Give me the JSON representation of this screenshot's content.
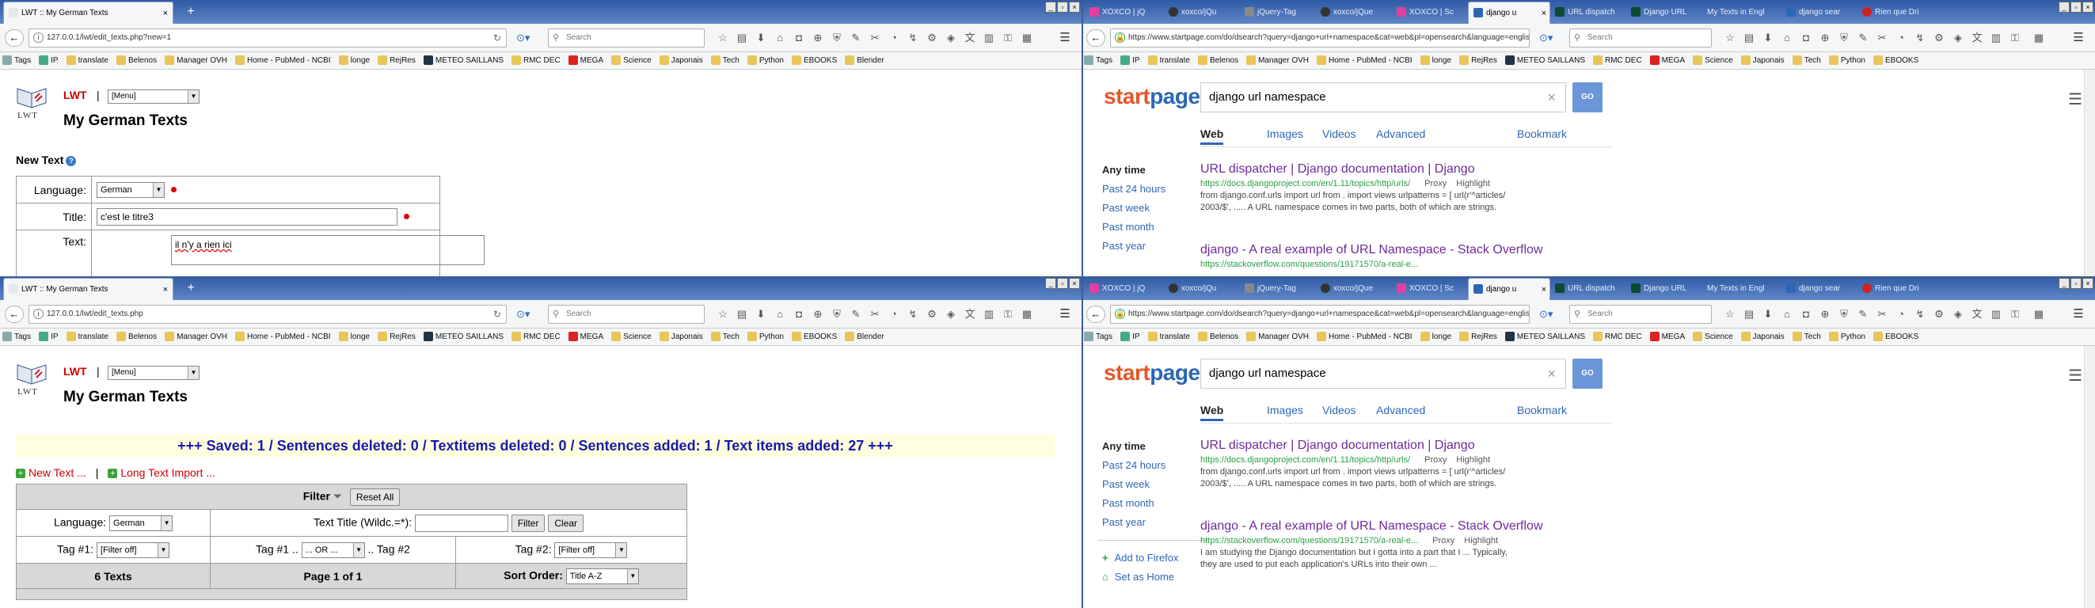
{
  "colors": {
    "tabbar": "#3a64ac",
    "accent_red": "#cc0000",
    "link_blue": "#2c67b6",
    "visited": "#6f2a9a",
    "url_green": "#28a243",
    "saved_bg": "#ffffe0"
  },
  "bookmarks": [
    {
      "label": "Tags",
      "icon": "tag-icon"
    },
    {
      "label": "IP",
      "icon": "ip-icon"
    },
    {
      "label": "translate",
      "icon": "folder-icon"
    },
    {
      "label": "Belenos",
      "icon": "folder-icon"
    },
    {
      "label": "Manager OVH",
      "icon": "folder-icon"
    },
    {
      "label": "Home - PubMed - NCBI",
      "icon": "ncbi-icon"
    },
    {
      "label": "longe",
      "icon": "folder-icon"
    },
    {
      "label": "RejRes",
      "icon": "folder-icon"
    },
    {
      "label": "METEO SAILLANS",
      "icon": "meteo-icon"
    },
    {
      "label": "RMC DEC",
      "icon": "rmc-icon"
    },
    {
      "label": "MEGA",
      "icon": "mega-icon"
    },
    {
      "label": "Science",
      "icon": "folder-icon"
    },
    {
      "label": "Japonais",
      "icon": "folder-icon"
    },
    {
      "label": "Tech",
      "icon": "folder-icon"
    },
    {
      "label": "Python",
      "icon": "folder-icon"
    },
    {
      "label": "EBOOKS",
      "icon": "folder-icon"
    },
    {
      "label": "Blender",
      "icon": "folder-icon"
    }
  ],
  "tl": {
    "tab": {
      "title": "LWT :: My German Texts",
      "close": "×"
    },
    "new_tab": "+",
    "url": "127.0.0.1/lwt/edit_texts.php?new=1",
    "search_placeholder": "Search",
    "lwt": {
      "name": "LWT",
      "pipe": "|",
      "menu": "[Menu]",
      "logo_text": "LWT",
      "heading": "My German Texts"
    },
    "form": {
      "section": "New Text",
      "help": "?",
      "language_label": "Language:",
      "language_value": "German",
      "title_label": "Title:",
      "title_value": "c'est le titre3",
      "text_label": "Text:",
      "text_value": "il n'y a rien ici"
    }
  },
  "tr": {
    "tabs": [
      "XOXCO | jQ",
      "xoxco/jQu",
      "jQuery-Tag",
      "xoxco/jQue",
      "XOXCO | Sc",
      "django u",
      "URL dispatch",
      "Django URL",
      "My Texts in Engl",
      "django sear",
      "Rien que Dri"
    ],
    "url": "https://www.startpage.com/do/dsearch?query=django+url+namespace&cat=web&pl=opensearch&language=english",
    "search_placeholder": "Search",
    "logo": {
      "part1": "start",
      "part2": "page"
    },
    "query": "django url namespace",
    "clear": "×",
    "go": "GO",
    "menu": "☰",
    "nav": [
      "Web",
      "Images",
      "Videos",
      "Advanced",
      "Bookmark"
    ],
    "filters": [
      "Any time",
      "Past 24 hours",
      "Past week",
      "Past month",
      "Past year"
    ],
    "results": [
      {
        "title": "URL dispatcher | Django documentation | Django",
        "url": "https://docs.djangoproject.com/en/1.11/topics/http/urls/",
        "proxy": "Proxy",
        "highlight": "Highlight",
        "desc1": "from django.conf.urls import url from . import views urlpatterns = [ url(r'^articles/",
        "desc2": "2003/$', ..... A URL namespace comes in two parts, both of which are strings."
      },
      {
        "title": "django - A real example of URL Namespace - Stack Overflow",
        "url": "https://stackoverflow.com/questions/19171570/a-real-e..."
      }
    ]
  },
  "bl": {
    "tab": {
      "title": "LWT :: My German Texts",
      "close": "×"
    },
    "new_tab": "+",
    "url": "127.0.0.1/lwt/edit_texts.php",
    "search_placeholder": "Search",
    "lwt": {
      "name": "LWT",
      "pipe": "|",
      "menu": "[Menu]",
      "logo_text": "LWT",
      "heading": "My German Texts"
    },
    "saved": "+++ Saved: 1 / Sentences deleted: 0 / Textitems deleted: 0 / Sentences added: 1 / Text items added: 27 +++",
    "new_text_link": "New Text ...",
    "link_sep": "|",
    "long_import_link": "Long Text Import ...",
    "filter": {
      "title": "Filter",
      "reset": "Reset All",
      "language_label": "Language:",
      "language_value": "German",
      "title_filter_label": "Text Title (Wildc.=*):",
      "filter_btn": "Filter",
      "clear_btn": "Clear",
      "tag1_label": "Tag #1:",
      "tag1_value": "[Filter off]",
      "tag_op_label1": "Tag #1 ..",
      "tag_op_value": "... OR ...",
      "tag_op_label2": ".. Tag #2",
      "tag2_label": "Tag #2:",
      "tag2_value": "[Filter off]",
      "count": "6 Texts",
      "page": "Page 1 of 1",
      "sort_label": "Sort Order:",
      "sort_value": "Title A-Z"
    }
  },
  "br": {
    "tabs": [
      "XOXCO | jQ",
      "xoxco/jQu",
      "jQuery-Tag",
      "xoxco/jQue",
      "XOXCO | Sc",
      "django u",
      "URL dispatch",
      "Django URL",
      "My Texts in Engl",
      "django sear",
      "Rien que Dri"
    ],
    "url": "https://www.startpage.com/do/dsearch?query=django+url+namespace&cat=web&pl=opensearch&language=english",
    "search_placeholder": "Search",
    "logo": {
      "part1": "start",
      "part2": "page"
    },
    "query": "django url namespace",
    "clear": "×",
    "go": "GO",
    "menu": "☰",
    "nav": [
      "Web",
      "Images",
      "Videos",
      "Advanced",
      "Bookmark"
    ],
    "filters": [
      "Any time",
      "Past 24 hours",
      "Past week",
      "Past month",
      "Past year"
    ],
    "results": [
      {
        "title": "URL dispatcher | Django documentation | Django",
        "url": "https://docs.djangoproject.com/en/1.11/topics/http/urls/",
        "proxy": "Proxy",
        "highlight": "Highlight",
        "desc1": "from django.conf.urls import url from . import views urlpatterns = [ url(r'^articles/",
        "desc2": "2003/$', ..... A URL namespace comes in two parts, both of which are strings."
      },
      {
        "title": "django - A real example of URL Namespace - Stack Overflow",
        "url": "https://stackoverflow.com/questions/19171570/a-real-e...",
        "proxy": "Proxy",
        "highlight": "Highlight",
        "desc1": "I am studying the Django documentation but I gotta into a part that I ... Typically,",
        "desc2": "they are used to put each application's URLs into their own ..."
      }
    ],
    "side_add": "Add to Firefox",
    "side_home": "Set as Home",
    "plus": "+"
  }
}
